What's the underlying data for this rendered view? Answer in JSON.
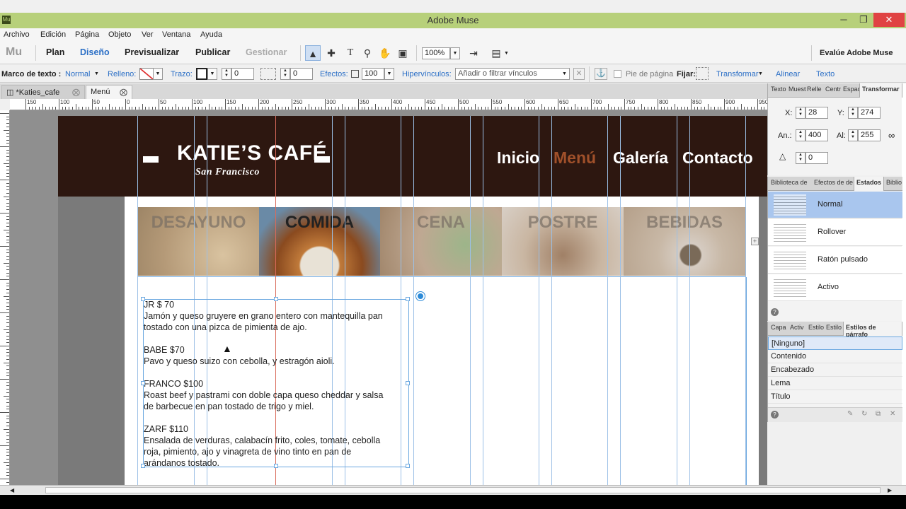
{
  "window": {
    "title": "Adobe Muse",
    "minimize": "─",
    "restore": "❐",
    "close": "✕"
  },
  "menu": [
    "Archivo",
    "Edición",
    "Página",
    "Objeto",
    "Ver",
    "Ventana",
    "Ayuda"
  ],
  "modes": {
    "logo": "Mu",
    "plan": "Plan",
    "design": "Diseño",
    "preview": "Previsualizar",
    "publish": "Publicar",
    "manage": "Gestionar",
    "zoom": "100%",
    "evaluate": "Evalúe Adobe Muse"
  },
  "control": {
    "text_frame_label": "Marco de texto :",
    "text_frame_value": "Normal",
    "fill": "Relleno:",
    "stroke": "Trazo:",
    "stroke_value": "0",
    "spacing_value": "0",
    "effects": "Efectos:",
    "effects_value": "100",
    "hyperlinks": "Hipervínculos:",
    "hyperlinks_placeholder": "Añadir o filtrar vínculos",
    "footer": "Pie de página",
    "pin": "Fijar:",
    "transform": "Transformar",
    "align": "Alinear",
    "text": "Texto"
  },
  "doc_tabs": [
    "*Katies_cafe",
    "Menú"
  ],
  "ruler_labels": [
    "150",
    "100",
    "50",
    "0",
    "50",
    "100",
    "150",
    "200",
    "250",
    "300",
    "350",
    "400",
    "450",
    "500",
    "550",
    "600",
    "650",
    "700",
    "750",
    "800",
    "850",
    "900",
    "950"
  ],
  "site": {
    "brand": "KATIE’S CAFÉ",
    "subtitle": "San Francisco",
    "nav": [
      "Inicio",
      "Menú",
      "Galería",
      "Contacto"
    ],
    "categories": [
      "DESAYUNO",
      "COMIDA",
      "CENA",
      "POSTRE",
      "BEBIDAS"
    ],
    "menu_text": [
      "JR $ 70",
      "Jamón y queso gruyere en grano entero con mantequilla pan",
      "tostado con una pizca de pimienta de ajo.",
      "",
      "BABE $70",
      "Pavo y queso suizo con cebolla, y estragón aioli.",
      "",
      "FRANCO $100",
      "Roast beef y pastrami con doble capa queso cheddar y salsa",
      "de barbecue en pan tostado de trigo y miel.",
      "",
      "ZARF $110",
      "Ensalada de verduras, calabacín frito, coles, tomate,  cebolla",
      "roja, pimiento, ajo y vinagreta de vino tinto en pan de",
      "arándanos tostado."
    ]
  },
  "transform_panel": {
    "tabs": [
      "Texto",
      "Muest",
      "Relle",
      "Centr",
      "Espac",
      "Transformar"
    ],
    "x_label": "X:",
    "x": "28",
    "y_label": "Y:",
    "y": "274",
    "w_label": "An.:",
    "w": "400",
    "h_label": "Al:",
    "h": "255",
    "rot": "0"
  },
  "states_panel": {
    "tabs": [
      "Biblioteca de",
      "Efectos de de",
      "Estados",
      "Biblio"
    ],
    "states": [
      "Normal",
      "Rollover",
      "Ratón pulsado",
      "Activo"
    ]
  },
  "styles_panel": {
    "tabs": [
      "Capa",
      "Activ",
      "Estilo",
      "Estilo",
      "Estilos de párrafo"
    ],
    "styles": [
      "[Ninguno]",
      "Contenido",
      "Encabezado",
      "Lema",
      "Título"
    ]
  },
  "colors": {
    "header_bg": "#2d1710",
    "nav_active": "#a0502a",
    "titlebar": "#b7d07a",
    "link": "#2b6fc6"
  }
}
